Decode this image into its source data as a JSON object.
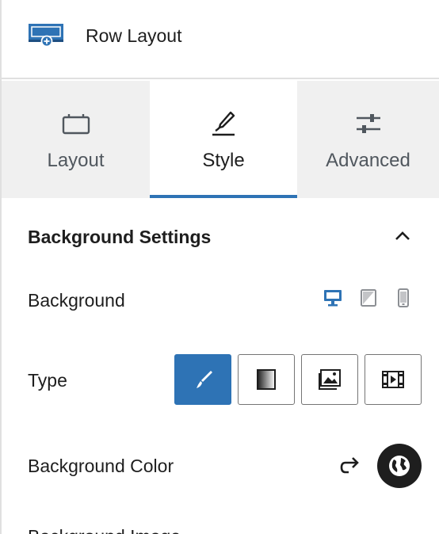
{
  "header": {
    "title": "Row Layout",
    "icon": "row-layout-icon"
  },
  "tabs": [
    {
      "label": "Layout",
      "icon": "layout-icon",
      "active": false
    },
    {
      "label": "Style",
      "icon": "brush-pen-icon",
      "active": true
    },
    {
      "label": "Advanced",
      "icon": "sliders-icon",
      "active": false
    }
  ],
  "section": {
    "title": "Background Settings",
    "expanded": true
  },
  "background": {
    "label": "Background",
    "devices": [
      "desktop",
      "tablet",
      "mobile"
    ],
    "active_device": "desktop"
  },
  "type": {
    "label": "Type",
    "options": [
      "color",
      "gradient",
      "image",
      "video"
    ],
    "selected": "color"
  },
  "background_color": {
    "label": "Background Color"
  },
  "partial_next_label": "Background Image",
  "colors": {
    "accent": "#2e73b5",
    "tab_bg": "#f0f0f0",
    "text": "#1e1e1e",
    "muted": "#50575e",
    "dark": "#1e1e1e"
  }
}
